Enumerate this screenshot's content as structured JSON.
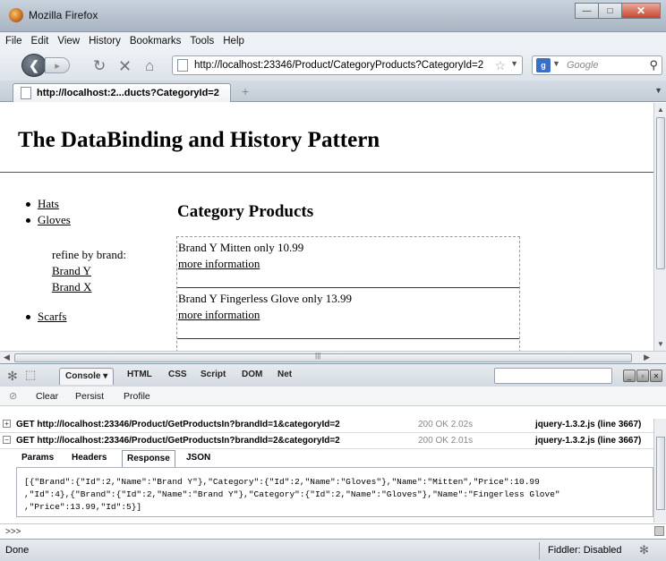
{
  "window": {
    "title": "Mozilla Firefox"
  },
  "menu": [
    "File",
    "Edit",
    "View",
    "History",
    "Bookmarks",
    "Tools",
    "Help"
  ],
  "navbar": {
    "url": "http://localhost:23346/Product/CategoryProducts?CategoryId=2",
    "search_placeholder": "Google"
  },
  "tab": {
    "label": "http://localhost:2...ducts?CategoryId=2",
    "new_tab": "+"
  },
  "page": {
    "title": "The DataBinding and History Pattern",
    "nav": [
      "Hats",
      "Gloves"
    ],
    "refine_label": "refine by brand:",
    "brands": [
      "Brand Y",
      "Brand X"
    ],
    "nav_last": "Scarfs",
    "heading": "Category Products",
    "products": [
      {
        "text": "Brand Y Mitten only 10.99",
        "link": "more information"
      },
      {
        "text": "Brand Y Fingerless Glove only 13.99",
        "link": "more information"
      }
    ]
  },
  "firebug": {
    "tabs": [
      "Console",
      "HTML",
      "CSS",
      "Script",
      "DOM",
      "Net"
    ],
    "commands": [
      "Clear",
      "Persist",
      "Profile"
    ],
    "requests": [
      {
        "url": "GET http://localhost:23346/Product/GetProductsIn?brandId=1&categoryId=2",
        "status": "200 OK 2.02s",
        "source": "jquery-1.3.2.js (line 3667)",
        "toggle": "+"
      },
      {
        "url": "GET http://localhost:23346/Product/GetProductsIn?brandId=2&categoryId=2",
        "status": "200 OK 2.01s",
        "source": "jquery-1.3.2.js (line 3667)",
        "toggle": "−"
      }
    ],
    "detail_tabs": [
      "Params",
      "Headers",
      "Response",
      "JSON"
    ],
    "response_lines": [
      "[{\"Brand\":{\"Id\":2,\"Name\":\"Brand Y\"},\"Category\":{\"Id\":2,\"Name\":\"Gloves\"},\"Name\":\"Mitten\",\"Price\":10.99",
      ",\"Id\":4},{\"Brand\":{\"Id\":2,\"Name\":\"Brand Y\"},\"Category\":{\"Id\":2,\"Name\":\"Gloves\"},\"Name\":\"Fingerless Glove\"",
      ",\"Price\":13.99,\"Id\":5}]"
    ],
    "prompt": ">>>"
  },
  "status": {
    "left": "Done",
    "fiddler": "Fiddler: Disabled"
  }
}
